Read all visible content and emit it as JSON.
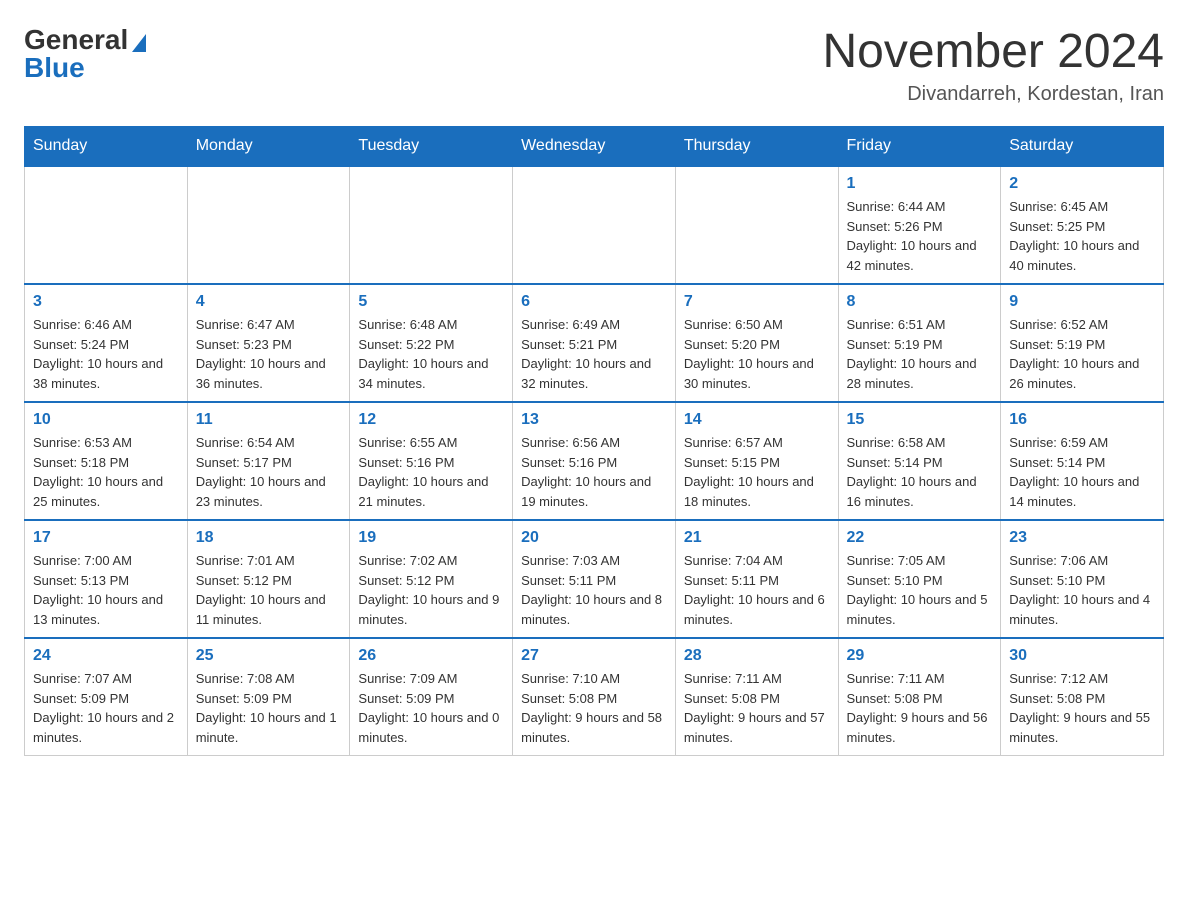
{
  "header": {
    "logo_text": "General",
    "logo_blue": "Blue",
    "month_year": "November 2024",
    "location": "Divandarreh, Kordestan, Iran"
  },
  "days_of_week": [
    "Sunday",
    "Monday",
    "Tuesday",
    "Wednesday",
    "Thursday",
    "Friday",
    "Saturday"
  ],
  "weeks": [
    [
      {
        "day": "",
        "info": ""
      },
      {
        "day": "",
        "info": ""
      },
      {
        "day": "",
        "info": ""
      },
      {
        "day": "",
        "info": ""
      },
      {
        "day": "",
        "info": ""
      },
      {
        "day": "1",
        "info": "Sunrise: 6:44 AM\nSunset: 5:26 PM\nDaylight: 10 hours and 42 minutes."
      },
      {
        "day": "2",
        "info": "Sunrise: 6:45 AM\nSunset: 5:25 PM\nDaylight: 10 hours and 40 minutes."
      }
    ],
    [
      {
        "day": "3",
        "info": "Sunrise: 6:46 AM\nSunset: 5:24 PM\nDaylight: 10 hours and 38 minutes."
      },
      {
        "day": "4",
        "info": "Sunrise: 6:47 AM\nSunset: 5:23 PM\nDaylight: 10 hours and 36 minutes."
      },
      {
        "day": "5",
        "info": "Sunrise: 6:48 AM\nSunset: 5:22 PM\nDaylight: 10 hours and 34 minutes."
      },
      {
        "day": "6",
        "info": "Sunrise: 6:49 AM\nSunset: 5:21 PM\nDaylight: 10 hours and 32 minutes."
      },
      {
        "day": "7",
        "info": "Sunrise: 6:50 AM\nSunset: 5:20 PM\nDaylight: 10 hours and 30 minutes."
      },
      {
        "day": "8",
        "info": "Sunrise: 6:51 AM\nSunset: 5:19 PM\nDaylight: 10 hours and 28 minutes."
      },
      {
        "day": "9",
        "info": "Sunrise: 6:52 AM\nSunset: 5:19 PM\nDaylight: 10 hours and 26 minutes."
      }
    ],
    [
      {
        "day": "10",
        "info": "Sunrise: 6:53 AM\nSunset: 5:18 PM\nDaylight: 10 hours and 25 minutes."
      },
      {
        "day": "11",
        "info": "Sunrise: 6:54 AM\nSunset: 5:17 PM\nDaylight: 10 hours and 23 minutes."
      },
      {
        "day": "12",
        "info": "Sunrise: 6:55 AM\nSunset: 5:16 PM\nDaylight: 10 hours and 21 minutes."
      },
      {
        "day": "13",
        "info": "Sunrise: 6:56 AM\nSunset: 5:16 PM\nDaylight: 10 hours and 19 minutes."
      },
      {
        "day": "14",
        "info": "Sunrise: 6:57 AM\nSunset: 5:15 PM\nDaylight: 10 hours and 18 minutes."
      },
      {
        "day": "15",
        "info": "Sunrise: 6:58 AM\nSunset: 5:14 PM\nDaylight: 10 hours and 16 minutes."
      },
      {
        "day": "16",
        "info": "Sunrise: 6:59 AM\nSunset: 5:14 PM\nDaylight: 10 hours and 14 minutes."
      }
    ],
    [
      {
        "day": "17",
        "info": "Sunrise: 7:00 AM\nSunset: 5:13 PM\nDaylight: 10 hours and 13 minutes."
      },
      {
        "day": "18",
        "info": "Sunrise: 7:01 AM\nSunset: 5:12 PM\nDaylight: 10 hours and 11 minutes."
      },
      {
        "day": "19",
        "info": "Sunrise: 7:02 AM\nSunset: 5:12 PM\nDaylight: 10 hours and 9 minutes."
      },
      {
        "day": "20",
        "info": "Sunrise: 7:03 AM\nSunset: 5:11 PM\nDaylight: 10 hours and 8 minutes."
      },
      {
        "day": "21",
        "info": "Sunrise: 7:04 AM\nSunset: 5:11 PM\nDaylight: 10 hours and 6 minutes."
      },
      {
        "day": "22",
        "info": "Sunrise: 7:05 AM\nSunset: 5:10 PM\nDaylight: 10 hours and 5 minutes."
      },
      {
        "day": "23",
        "info": "Sunrise: 7:06 AM\nSunset: 5:10 PM\nDaylight: 10 hours and 4 minutes."
      }
    ],
    [
      {
        "day": "24",
        "info": "Sunrise: 7:07 AM\nSunset: 5:09 PM\nDaylight: 10 hours and 2 minutes."
      },
      {
        "day": "25",
        "info": "Sunrise: 7:08 AM\nSunset: 5:09 PM\nDaylight: 10 hours and 1 minute."
      },
      {
        "day": "26",
        "info": "Sunrise: 7:09 AM\nSunset: 5:09 PM\nDaylight: 10 hours and 0 minutes."
      },
      {
        "day": "27",
        "info": "Sunrise: 7:10 AM\nSunset: 5:08 PM\nDaylight: 9 hours and 58 minutes."
      },
      {
        "day": "28",
        "info": "Sunrise: 7:11 AM\nSunset: 5:08 PM\nDaylight: 9 hours and 57 minutes."
      },
      {
        "day": "29",
        "info": "Sunrise: 7:11 AM\nSunset: 5:08 PM\nDaylight: 9 hours and 56 minutes."
      },
      {
        "day": "30",
        "info": "Sunrise: 7:12 AM\nSunset: 5:08 PM\nDaylight: 9 hours and 55 minutes."
      }
    ]
  ]
}
